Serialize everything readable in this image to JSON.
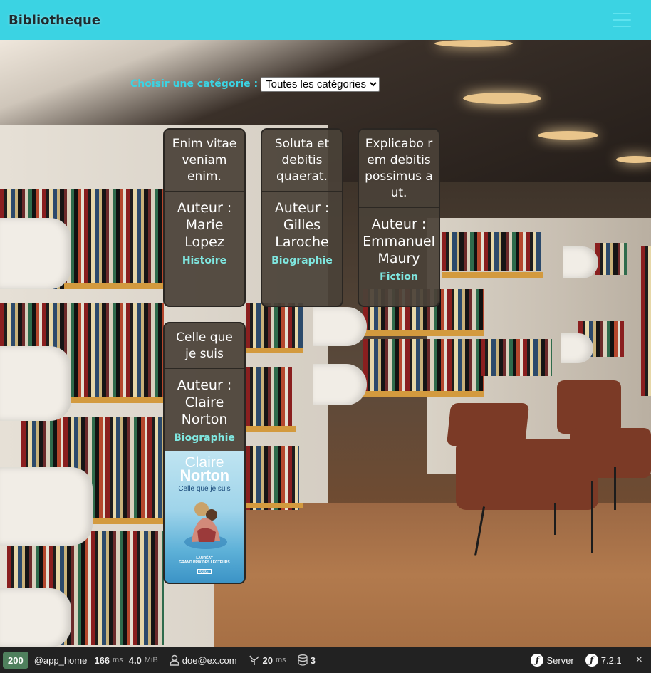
{
  "header": {
    "brand": "Bibliotheque",
    "menu_icon": "hamburger-icon"
  },
  "filter": {
    "label": "Choisir une catégorie :",
    "selected": "Toutes les catégories"
  },
  "books": [
    {
      "title": "Enim vitae veniam enim.",
      "author_label": "Auteur :",
      "author": "Marie Lopez",
      "category": "Histoire"
    },
    {
      "title": "Soluta et debitis quaerat.",
      "author_label": "Auteur :",
      "author": "Gilles Laroche",
      "category": "Biographie"
    },
    {
      "title": "Explicabo rem debitis possimus aut.",
      "author_label": "Auteur :",
      "author": "Emmanuel Maury",
      "category": "Fiction"
    },
    {
      "title": "Celle que je suis",
      "author_label": "Auteur :",
      "author": "Claire Norton",
      "category": "Biographie",
      "cover": {
        "first_name": "Claire",
        "last_name": "Norton",
        "title": "Celle que je suis",
        "prize_line1": "LAURÉAT",
        "prize_line2": "GRAND PRIX DES LECTEURS",
        "publisher": "POCKET"
      }
    }
  ],
  "toolbar": {
    "status": "200",
    "route": "@app_home",
    "time_value": "166",
    "time_unit": "ms",
    "memory_value": "4.0",
    "memory_unit": "MiB",
    "user": "doe@ex.com",
    "twig_value": "20",
    "twig_unit": "ms",
    "db_queries": "3",
    "server_label": "Server",
    "symfony_version": "7.2.1",
    "close": "×",
    "status_color": "#4f805d"
  },
  "colors": {
    "header_bg": "#3bd3e3",
    "accent": "#3bd3e3",
    "category": "#7fe7e0"
  }
}
